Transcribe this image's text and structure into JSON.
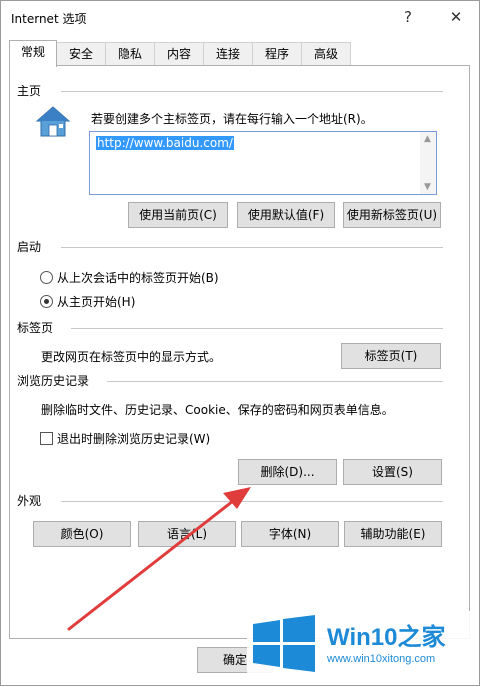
{
  "window": {
    "title": "Internet 选项",
    "help_glyph": "?",
    "close_glyph": "✕"
  },
  "tabs": [
    {
      "label": "常规"
    },
    {
      "label": "安全"
    },
    {
      "label": "隐私"
    },
    {
      "label": "内容"
    },
    {
      "label": "连接"
    },
    {
      "label": "程序"
    },
    {
      "label": "高级"
    }
  ],
  "homepage": {
    "group_label": "主页",
    "instruction": "若要创建多个主标签页，请在每行输入一个地址(R)。",
    "url_value": "http://www.baidu.com/",
    "use_current_label": "使用当前页(C)",
    "use_default_label": "使用默认值(F)",
    "use_new_tab_label": "使用新标签页(U)"
  },
  "startup": {
    "group_label": "启动",
    "option_last_session": "从上次会话中的标签页开始(B)",
    "option_homepage": "从主页开始(H)",
    "selected": "option_homepage"
  },
  "tabs_section": {
    "group_label": "标签页",
    "description": "更改网页在标签页中的显示方式。",
    "button_label": "标签页(T)"
  },
  "history": {
    "group_label": "浏览历史记录",
    "description": "删除临时文件、历史记录、Cookie、保存的密码和网页表单信息。",
    "delete_on_exit_label": "退出时删除浏览历史记录(W)",
    "delete_on_exit_checked": false,
    "delete_button_label": "删除(D)...",
    "settings_button_label": "设置(S)"
  },
  "appearance": {
    "group_label": "外观",
    "colors_label": "颜色(O)",
    "languages_label": "语言(L)",
    "fonts_label": "字体(N)",
    "accessibility_label": "辅助功能(E)"
  },
  "footer": {
    "ok_label": "确定"
  },
  "watermark": {
    "title": "Win10之家",
    "url": "www.win10xitong.com"
  },
  "colors": {
    "selection": "#3399ff",
    "annotation_arrow": "#e03c3c",
    "watermark_blue": "#1c8ad6"
  }
}
